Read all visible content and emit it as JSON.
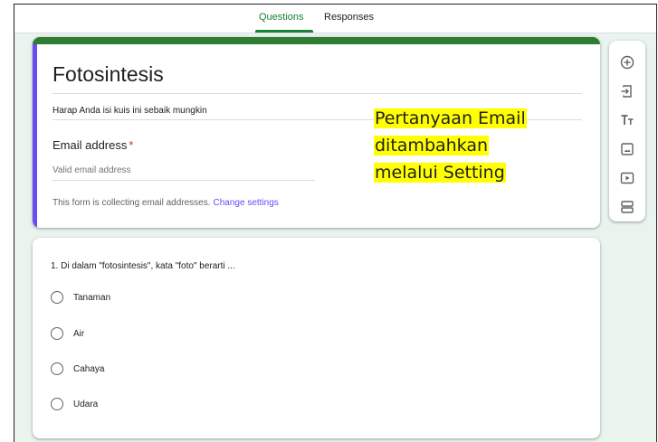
{
  "tabs": [
    {
      "label": "Questions",
      "active": true
    },
    {
      "label": "Responses",
      "active": false
    }
  ],
  "form": {
    "title": "Fotosintesis",
    "description": "Harap Anda isi kuis ini sebaik mungkin",
    "email_label": "Email address",
    "required_mark": "*",
    "email_placeholder": "Valid email address",
    "collect_note": "This form is collecting email addresses.",
    "change_settings_link": "Change settings"
  },
  "annotation": {
    "lines": [
      "Pertanyaan Email",
      "ditambahkan",
      "melalui Setting"
    ],
    "highlight_color": "#ffff00"
  },
  "toolbar": {
    "tools": [
      {
        "icon": "add-question-icon"
      },
      {
        "icon": "import-questions-icon"
      },
      {
        "icon": "title-text-icon"
      },
      {
        "icon": "image-icon"
      },
      {
        "icon": "video-icon"
      },
      {
        "icon": "section-icon"
      }
    ]
  },
  "question": {
    "text": "1. Di dalam \"fotosintesis\", kata \"foto\" berarti ...",
    "options": [
      "Tanaman",
      "Air",
      "Cahaya",
      "Udara"
    ]
  },
  "colors": {
    "accent_green": "#188038",
    "header_band": "#2e7d32",
    "left_bar": "#6c4bf0",
    "background": "#eaf4ee",
    "required": "#d93025"
  }
}
